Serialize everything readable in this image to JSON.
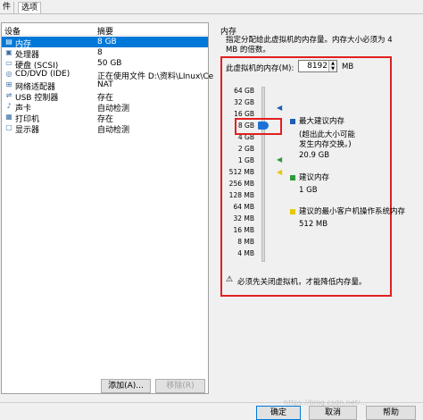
{
  "tabs": {
    "hardware": "件",
    "options": "选项"
  },
  "device_list": {
    "header_device": "设备",
    "header_summary": "摘要",
    "rows": [
      {
        "icon": "memory-icon",
        "name": "内存",
        "summary": "8 GB",
        "selected": true
      },
      {
        "icon": "processor-icon",
        "name": "处理器",
        "summary": "8"
      },
      {
        "icon": "hard-disk-icon",
        "name": "硬盘 (SCSI)",
        "summary": "50 GB"
      },
      {
        "icon": "cd-dvd-icon",
        "name": "CD/DVD (IDE)",
        "summary": "正在使用文件 D:\\资料\\LInux\\Ce"
      },
      {
        "icon": "network-adapter-icon",
        "name": "网络适配器",
        "summary": "NAT"
      },
      {
        "icon": "usb-icon",
        "name": "USB 控制器",
        "summary": "存在"
      },
      {
        "icon": "sound-card-icon",
        "name": "声卡",
        "summary": "自动检测"
      },
      {
        "icon": "printer-icon",
        "name": "打印机",
        "summary": "存在"
      },
      {
        "icon": "display-icon",
        "name": "显示器",
        "summary": "自动检测"
      }
    ]
  },
  "buttons": {
    "add": "添加(A)...",
    "remove": "移除(R)",
    "ok": "确定",
    "cancel": "取消",
    "help": "帮助"
  },
  "memory": {
    "group_title": "内存",
    "description": "指定分配给此虚拟机的内存量。内存大小必须为 4 MB 的倍数。",
    "memory_label": "此虚拟机的内存(M):",
    "value": "8192",
    "unit": "MB",
    "scale_labels": [
      "64 GB",
      "32 GB",
      "16 GB",
      "8 GB",
      "4 GB",
      "2 GB",
      "1 GB",
      "512 MB",
      "256 MB",
      "128 MB",
      "64 MB",
      "32 MB",
      "16 MB",
      "8 MB",
      "4 MB"
    ],
    "max_recommended_title": "最大建议内存",
    "max_recommended_note": "(超出此大小可能发生内存交换。)",
    "max_recommended_value": "20.9 GB",
    "recommended_title": "建议内存",
    "recommended_value": "1 GB",
    "min_guest_title": "建议的最小客户机操作系统内存",
    "min_guest_value": "512 MB",
    "warning": "必须先关闭虚拟机，才能降低内存量。",
    "colors": {
      "max": "#1e5fb4",
      "recommended": "#2e9a3a",
      "minimum": "#e8c800"
    }
  },
  "watermark": "https://blog.csdn.net/..."
}
